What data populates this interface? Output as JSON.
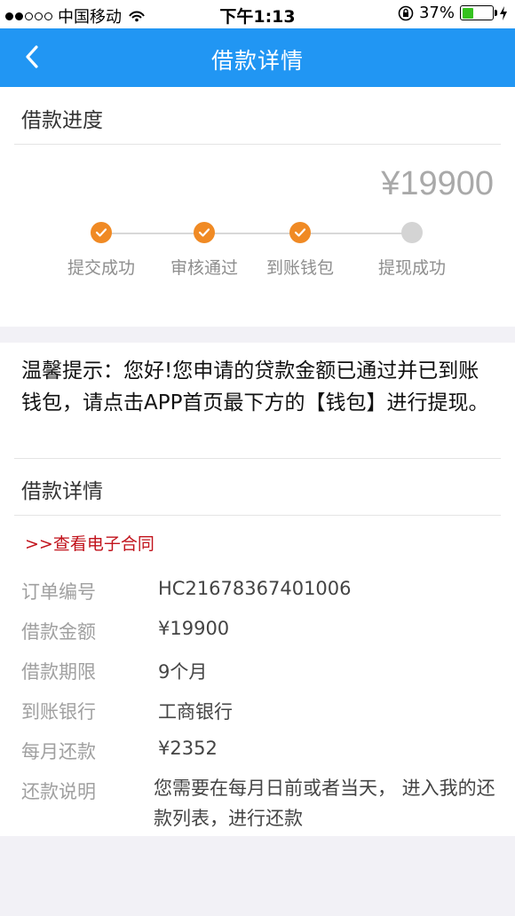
{
  "status_bar": {
    "carrier": "中国移动",
    "time": "下午1:13",
    "battery": "37%",
    "battery_level": 0.37
  },
  "nav": {
    "title": "借款详情",
    "back_icon": "chevron-left-icon"
  },
  "progress": {
    "title": "借款进度",
    "amount": "¥19900",
    "steps": [
      {
        "label": "提交成功",
        "done": true
      },
      {
        "label": "审核通过",
        "done": true
      },
      {
        "label": "到账钱包",
        "done": true
      },
      {
        "label": "提现成功",
        "done": false
      }
    ]
  },
  "notice": "温馨提示：您好!您申请的贷款金额已通过并已到账钱包，请点击APP首页最下方的【钱包】进行提现。",
  "details": {
    "title": "借款详情",
    "contract_link": ">>查看电子合同",
    "rows": [
      {
        "label": "订单编号",
        "value": "HC21678367401006"
      },
      {
        "label": "借款金额",
        "value": "¥19900"
      },
      {
        "label": "借款期限",
        "value": "9个月"
      },
      {
        "label": "到账银行",
        "value": "工商银行"
      },
      {
        "label": "每月还款",
        "value": "¥2352"
      },
      {
        "label": "还款说明",
        "value": "您需要在每月日前或者当天， 进入我的还款列表，进行还款"
      }
    ]
  },
  "colors": {
    "primary": "#2196f3",
    "step_done": "#f08a24",
    "step_todo": "#d4d4d4",
    "link": "#c1121b"
  }
}
